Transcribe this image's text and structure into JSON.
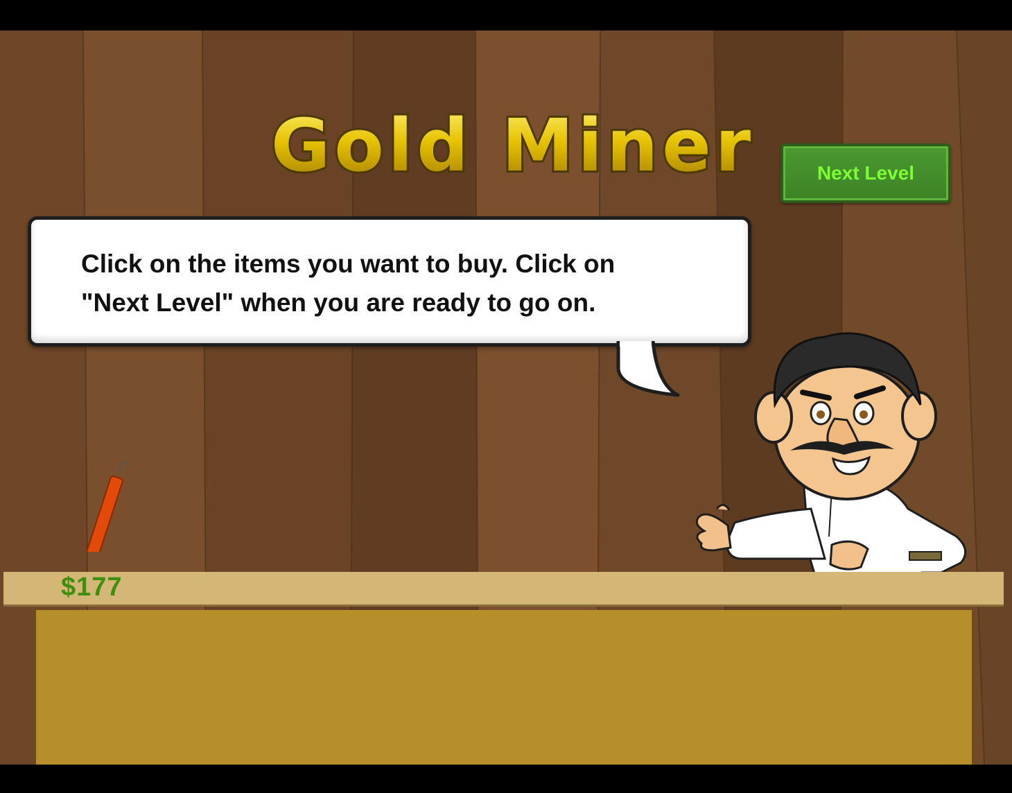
{
  "game": {
    "title": "Gold Miner",
    "next_level_label": "Next Level",
    "instruction_line1": "Click on the items you want to buy. Click on",
    "instruction_line2": "\"Next Level\" when you are ready to go on.",
    "money": "$177"
  },
  "shop": {
    "items": [
      {
        "name": "dynamite",
        "icon": "dynamite-icon"
      }
    ]
  },
  "colors": {
    "wood": "#6b4527",
    "counter_top": "#d4b677",
    "counter_front": "#b68f2b",
    "button": "#4b9a30",
    "button_text": "#7dff35",
    "money_text": "#3f8f0e",
    "title_gold": "#e6c200"
  }
}
